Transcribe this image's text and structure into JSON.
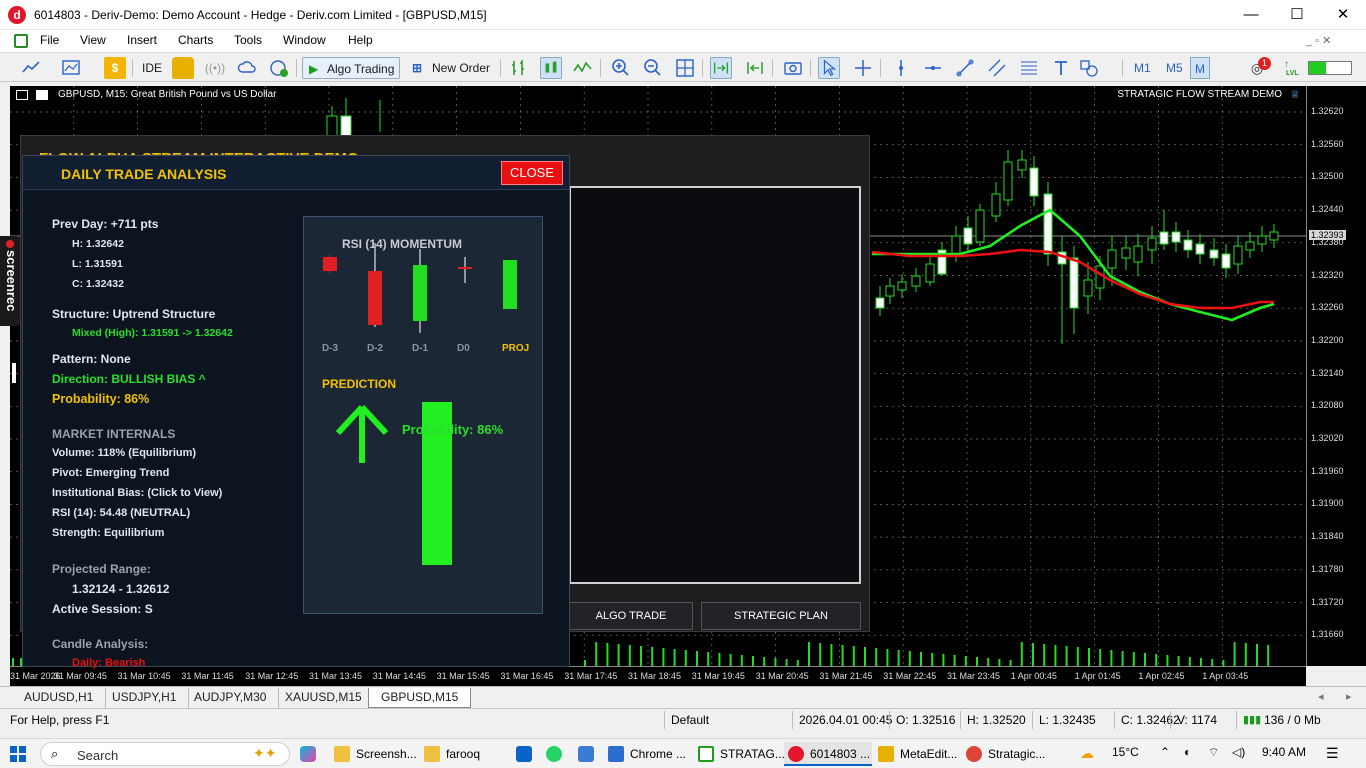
{
  "window": {
    "title": "6014803 - Deriv-Demo: Demo Account - Hedge - Deriv.com Limited - [GBPUSD,M15]",
    "logo_letter": "d",
    "minimize": "—",
    "maximize": "☐",
    "close": "✕"
  },
  "menu": [
    "File",
    "View",
    "Insert",
    "Charts",
    "Tools",
    "Window",
    "Help"
  ],
  "toolbar": {
    "ide": "IDE",
    "algo_trading": "Algo Trading",
    "new_order": "New Order",
    "timeframes": [
      "M1",
      "M5",
      "M"
    ],
    "notification_count": "1",
    "signal_label": "LVL"
  },
  "chart": {
    "symbol_label": "GBPUSD, M15:  Great British Pound vs US Dollar",
    "ea_label": "STRATAGIC FLOW STREAM DEMO",
    "current_price": "1.32393",
    "price_ticks": [
      "1.32620",
      "1.32560",
      "1.32500",
      "1.32440",
      "1.32380",
      "1.32320",
      "1.32260",
      "1.32200",
      "1.32140",
      "1.32080",
      "1.32020",
      "1.31960",
      "1.31900",
      "1.31840",
      "1.31780",
      "1.31720",
      "1.31660"
    ],
    "time_ticks": [
      "31 Mar 2026",
      "31 Mar 09:45",
      "31 Mar 10:45",
      "31 Mar 11:45",
      "31 Mar 12:45",
      "31 Mar 13:45",
      "31 Mar 14:45",
      "31 Mar 15:45",
      "31 Mar 16:45",
      "31 Mar 17:45",
      "31 Mar 18:45",
      "31 Mar 19:45",
      "31 Mar 20:45",
      "31 Mar 21:45",
      "31 Mar 22:45",
      "31 Mar 23:45",
      "1 Apr 00:45",
      "1 Apr 01:45",
      "1 Apr 02:45",
      "1 Apr 03:45"
    ]
  },
  "background_panel": {
    "title": "FLOW ALPHA STREAM  INTERACTIVE DEMO",
    "buttons": [
      "ALGO TRADE",
      "STRATEGIC PLAN"
    ]
  },
  "analysis": {
    "title": "DAILY TRADE ANALYSIS",
    "close_label": "CLOSE",
    "prev_day": "Prev Day: +711 pts",
    "high": "H: 1.32642",
    "low": "L: 1.31591",
    "close": "C: 1.32432",
    "structure": "Structure: Uptrend Structure",
    "structure_detail": "Mixed (High): 1.31591 -> 1.32642",
    "pattern": "Pattern: None",
    "direction": "Direction: BULLISH BIAS ^",
    "probability": "Probability: 86%",
    "internals_header": "MARKET INTERNALS",
    "volume": "Volume: 118% (Equilibrium)",
    "pivot": "Pivot: Emerging Trend",
    "institutional_bias": "Institutional Bias: (Click to View)",
    "rsi": "RSI (14): 54.48 (NEUTRAL)",
    "strength": "Strength: Equilibrium",
    "projected_header": "Projected Range:",
    "projected_range": "1.32124 - 1.32612",
    "active_session": "Active Session: S",
    "candle_header": "Candle Analysis:",
    "candle_daily": "Daily: Bearish",
    "rsi_box": {
      "header": "RSI (14) MOMENTUM",
      "candle_labels": [
        "D-3",
        "D-2",
        "D-1",
        "D0",
        "PROJ"
      ],
      "prediction_header": "PREDICTION",
      "prediction_probability": "Probability: 86%",
      "probability_value": 86
    }
  },
  "tabs": [
    "AUDUSD,H1",
    "USDJPY,H1",
    "AUDJPY,M30",
    "XAUUSD,M15",
    "GBPUSD,M15"
  ],
  "statusbar": {
    "help": "For Help, press F1",
    "profile": "Default",
    "datetime": "2026.04.01 00:45",
    "open": "O: 1.32516",
    "high": "H: 1.32520",
    "low": "L: 1.32435",
    "close": "C: 1.32462",
    "volume": "V: 1174",
    "traffic": "136 / 0 Mb"
  },
  "taskbar": {
    "search": "Search",
    "apps": [
      "Screensh...",
      "farooq",
      "Chrome ...",
      "STRATAG...",
      "6014803 ...",
      "MetaEdit...",
      "Stratagic..."
    ],
    "weather": "15°C",
    "time": "9:40 AM"
  },
  "overlay": {
    "screenrec": "screenrec"
  }
}
